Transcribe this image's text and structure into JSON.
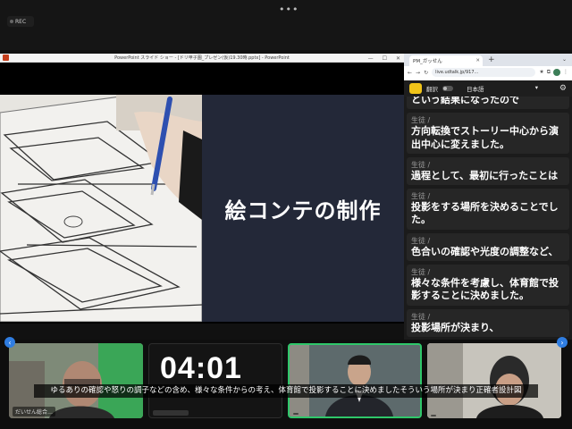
{
  "meeting": {
    "rec_label": "REC",
    "more_dots": "•••"
  },
  "powerpoint": {
    "window_title": "PowerPoint スライド ショー - [ドリ甲子園_プレゼン(仮)19.30時.pptx] - PowerPoint",
    "slide_heading": "絵コンテの制作"
  },
  "browser": {
    "tab_title": "PM_ガッせん",
    "tab_close": "✕",
    "new_tab": "+",
    "url": "live.udtalk.jp/917...",
    "nav_back": "←",
    "nav_forward": "→",
    "reload": "↻"
  },
  "app_toolbar": {
    "translate_label": "翻訳",
    "language": "日本語",
    "language_arrow": "▾"
  },
  "transcript": [
    {
      "speaker": "",
      "text": "という結果になったので"
    },
    {
      "speaker": "生徒 /",
      "text": "方向転換でストーリー中心から演出中心に変えました。"
    },
    {
      "speaker": "生徒 /",
      "text": "過程として、最初に行ったことは"
    },
    {
      "speaker": "生徒 /",
      "text": "投影をする場所を決めることでした。"
    },
    {
      "speaker": "生徒 /",
      "text": "色合いの確認や光度の調整など、"
    },
    {
      "speaker": "生徒 /",
      "text": "様々な条件を考慮し、体育館で投影することに決めました。"
    },
    {
      "speaker": "生徒 /",
      "text": "投影場所が決まり、"
    }
  ],
  "participants": [
    {
      "name": "だいせん総合…"
    },
    {
      "timer": "04:01",
      "name": ""
    },
    {
      "name": ""
    },
    {
      "name": ""
    }
  ],
  "caption": "ゆるありの確認や怒りの調子などの含め、様々な条件からの考え、体育館で投影することに決めましたそういう場所が決まり正確者設計図",
  "colors": {
    "slide_dark": "#232838",
    "active_speaker": "#2fc76a",
    "accent_blue": "#2f7de1"
  }
}
